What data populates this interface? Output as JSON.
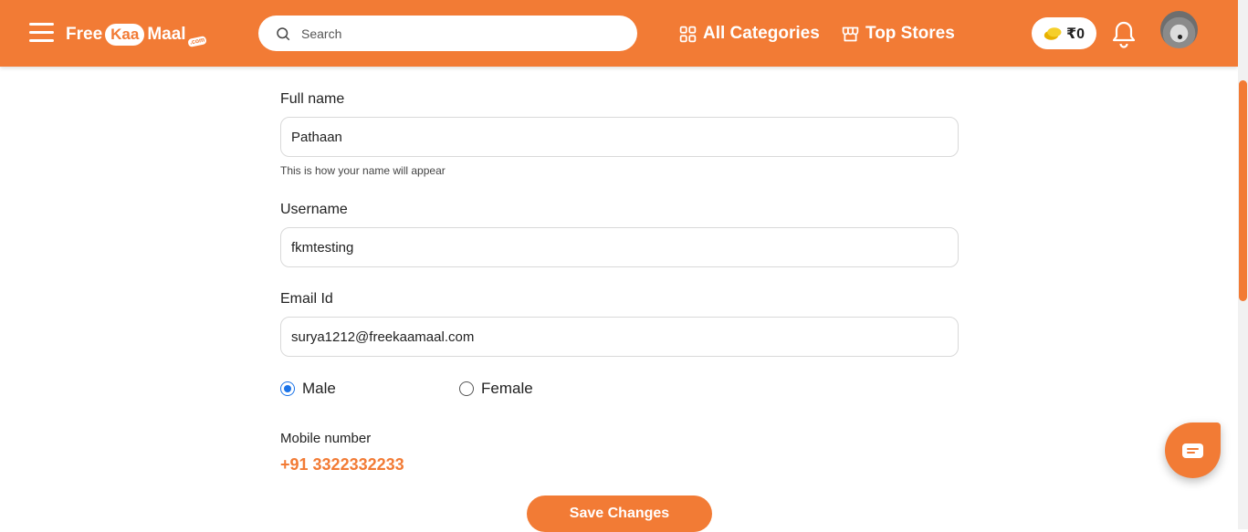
{
  "header": {
    "logo": {
      "part1": "Free",
      "part2": "Kaa",
      "part3": "Maal",
      "suffix": ".com"
    },
    "search_placeholder": "Search",
    "nav": {
      "categories": "All Categories",
      "stores": "Top Stores"
    },
    "coins": "₹0"
  },
  "form": {
    "full_name": {
      "label": "Full name",
      "value": "Pathaan",
      "hint": "This is how your name will appear"
    },
    "username": {
      "label": "Username",
      "value": "fkmtesting"
    },
    "email": {
      "label": "Email Id",
      "value": "surya1212@freekaamaal.com"
    },
    "gender": {
      "options": [
        "Male",
        "Female"
      ],
      "selected": "Male"
    },
    "mobile": {
      "label": "Mobile number",
      "value": "+91 3322332233"
    },
    "save_label": "Save Changes"
  },
  "colors": {
    "brand": "#f27b35",
    "radio_active": "#1a73e8"
  },
  "icons": [
    "hamburger-icon",
    "search-icon",
    "grid-icon",
    "store-icon",
    "coin-icon",
    "bell-icon",
    "chat-icon"
  ]
}
